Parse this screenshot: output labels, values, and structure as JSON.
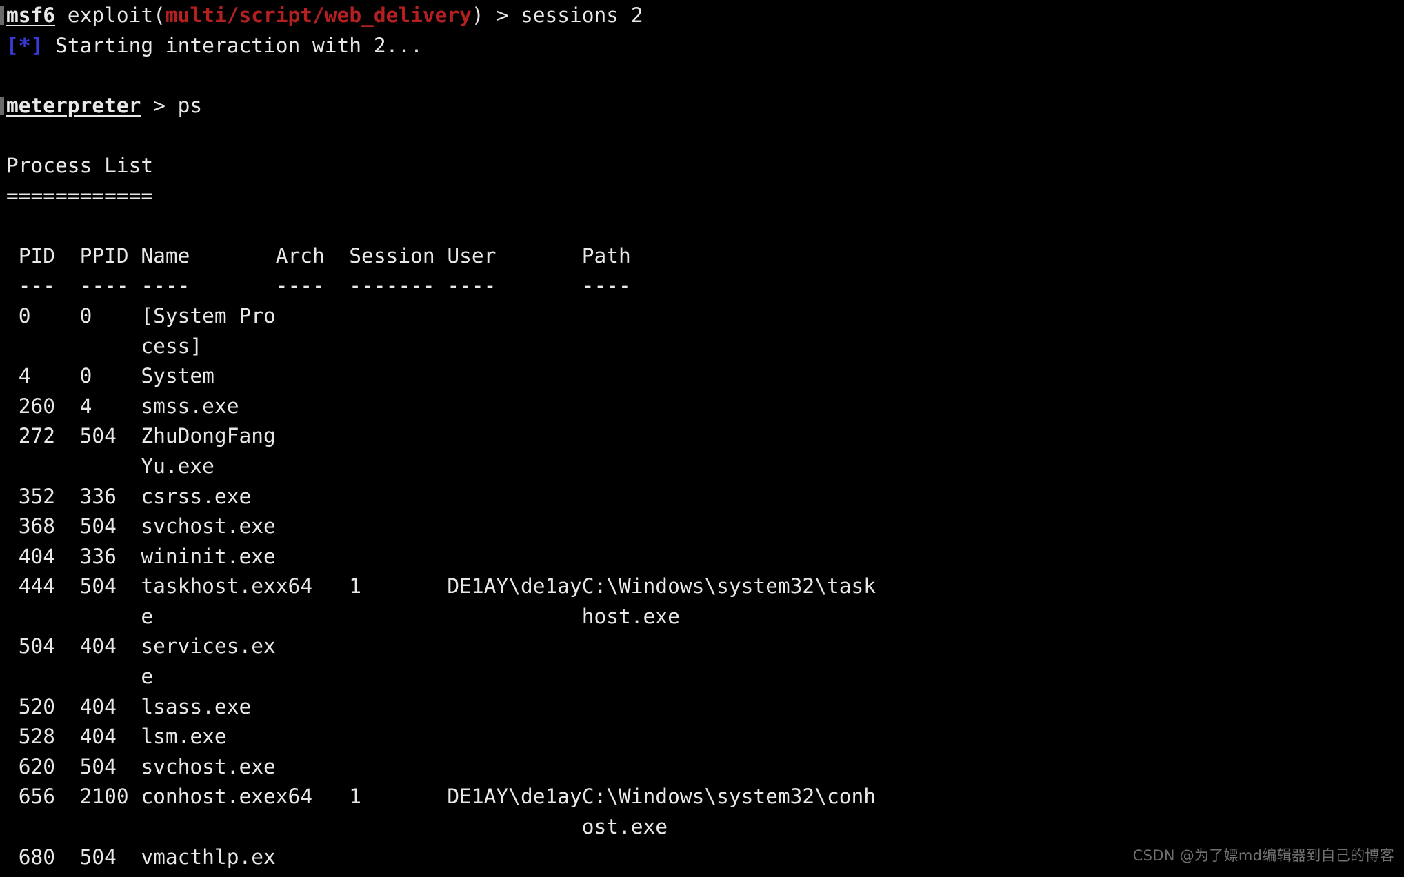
{
  "terminal": {
    "background_color": "#000000",
    "foreground_color": "#e8e8e8",
    "prompt_red_color": "#b42020",
    "info_blue_color": "#3a3ad9",
    "watermark_color": "#707070"
  },
  "prompt_line": {
    "shell": "msf6",
    "module_keyword": " exploit(",
    "module_path": "multi/script/web_delivery",
    "close_paren": ")",
    "caret": " > ",
    "command": "sessions 2"
  },
  "status_line": {
    "marker": "[*]",
    "text": " Starting interaction with 2..."
  },
  "meterpreter_line": {
    "prompt": "meterpreter",
    "caret": " > ",
    "command": "ps"
  },
  "section": {
    "title": "Process List",
    "underline": "============"
  },
  "table": {
    "headers": [
      "PID",
      "PPID",
      "Name",
      "Arch",
      "Session",
      "User",
      "Path"
    ],
    "separators": [
      "---",
      "----",
      "----",
      "----",
      "-------",
      "----",
      "----"
    ],
    "rows": [
      {
        "pid": "0",
        "ppid": "0",
        "name": "[System Pro",
        "name_cont": "cess]",
        "arch": "",
        "session": "",
        "user": "",
        "path": "",
        "path_cont": ""
      },
      {
        "pid": "4",
        "ppid": "0",
        "name": "System",
        "name_cont": "",
        "arch": "",
        "session": "",
        "user": "",
        "path": "",
        "path_cont": ""
      },
      {
        "pid": "260",
        "ppid": "4",
        "name": "smss.exe",
        "name_cont": "",
        "arch": "",
        "session": "",
        "user": "",
        "path": "",
        "path_cont": ""
      },
      {
        "pid": "272",
        "ppid": "504",
        "name": "ZhuDongFang",
        "name_cont": "Yu.exe",
        "arch": "",
        "session": "",
        "user": "",
        "path": "",
        "path_cont": ""
      },
      {
        "pid": "352",
        "ppid": "336",
        "name": "csrss.exe",
        "name_cont": "",
        "arch": "",
        "session": "",
        "user": "",
        "path": "",
        "path_cont": ""
      },
      {
        "pid": "368",
        "ppid": "504",
        "name": "svchost.exe",
        "name_cont": "",
        "arch": "",
        "session": "",
        "user": "",
        "path": "",
        "path_cont": ""
      },
      {
        "pid": "404",
        "ppid": "336",
        "name": "wininit.exe",
        "name_cont": "",
        "arch": "",
        "session": "",
        "user": "",
        "path": "",
        "path_cont": ""
      },
      {
        "pid": "444",
        "ppid": "504",
        "name": "taskhost.ex",
        "name_cont": "e",
        "arch": "x64",
        "session": "1",
        "user": "DE1AY\\de1ay",
        "path": "C:\\Windows\\system32\\task",
        "path_cont": "host.exe"
      },
      {
        "pid": "504",
        "ppid": "404",
        "name": "services.ex",
        "name_cont": "e",
        "arch": "",
        "session": "",
        "user": "",
        "path": "",
        "path_cont": ""
      },
      {
        "pid": "520",
        "ppid": "404",
        "name": "lsass.exe",
        "name_cont": "",
        "arch": "",
        "session": "",
        "user": "",
        "path": "",
        "path_cont": ""
      },
      {
        "pid": "528",
        "ppid": "404",
        "name": "lsm.exe",
        "name_cont": "",
        "arch": "",
        "session": "",
        "user": "",
        "path": "",
        "path_cont": ""
      },
      {
        "pid": "620",
        "ppid": "504",
        "name": "svchost.exe",
        "name_cont": "",
        "arch": "",
        "session": "",
        "user": "",
        "path": "",
        "path_cont": ""
      },
      {
        "pid": "656",
        "ppid": "2100",
        "name": "conhost.exe",
        "name_cont": "",
        "arch": "x64",
        "session": "1",
        "user": "DE1AY\\de1ay",
        "path": "C:\\Windows\\system32\\conh",
        "path_cont": "ost.exe"
      },
      {
        "pid": "680",
        "ppid": "504",
        "name": "vmacthlp.ex",
        "name_cont": "",
        "arch": "",
        "session": "",
        "user": "",
        "path": "",
        "path_cont": ""
      }
    ]
  },
  "watermark": {
    "text": "CSDN @为了嫖md编辑器到自己的博客"
  }
}
